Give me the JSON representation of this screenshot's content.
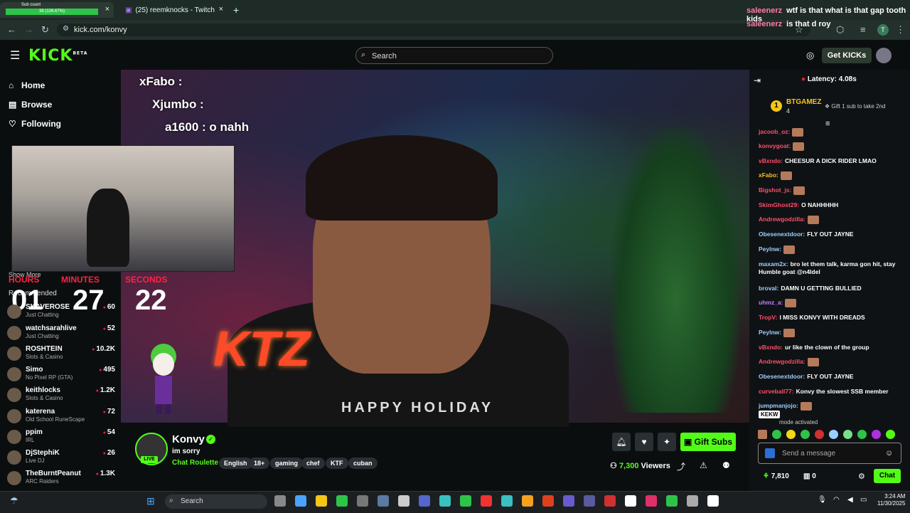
{
  "browser": {
    "tab1": {
      "title": "Sub count",
      "bar_text": "38 (126.67%)"
    },
    "tab2": {
      "title": "(25) reemknocks - Twitch"
    },
    "url": "kick.com/konvy",
    "close_glyph": "×",
    "new_tab_glyph": "+"
  },
  "overlay_chat": [
    {
      "user": "saleenerz",
      "text": "wtf is that what is that gap tooth kids"
    },
    {
      "user": "saleenerz",
      "text": "is that d roy"
    }
  ],
  "header": {
    "logo": "KICK",
    "logo_sup": "BETA",
    "search_placeholder": "Search",
    "get_kicks": "Get KICKs"
  },
  "sidebar": {
    "nav": [
      {
        "label": "Home",
        "icon": "home-icon"
      },
      {
        "label": "Browse",
        "icon": "browse-icon"
      },
      {
        "label": "Following",
        "icon": "heart-icon"
      }
    ],
    "show_more": "Show More",
    "recommended": "Recommended",
    "channels": [
      {
        "name": "SKAVEROSE",
        "category": "Just Chatting",
        "viewers": "60"
      },
      {
        "name": "watchsarahlive",
        "category": "Just Chatting",
        "viewers": "52"
      },
      {
        "name": "ROSHTEIN",
        "category": "Slots & Casino",
        "viewers": "10.2K"
      },
      {
        "name": "Simo",
        "category": "No Pixel RP (GTA)",
        "viewers": "495"
      },
      {
        "name": "keithlocks",
        "category": "Slots & Casino",
        "viewers": "1.2K"
      },
      {
        "name": "katerena",
        "category": "Old School RuneScape",
        "viewers": "72"
      },
      {
        "name": "ppim",
        "category": "IRL",
        "viewers": "54"
      },
      {
        "name": "DjStephiK",
        "category": "Live DJ",
        "viewers": "26"
      },
      {
        "name": "TheBurntPeanut",
        "category": "ARC Raiders",
        "viewers": "1.3K"
      }
    ]
  },
  "video": {
    "overlay_chat": [
      {
        "text": "xFabo :"
      },
      {
        "text": "Xjumbo :"
      },
      {
        "text": "a1600 : o nahh"
      }
    ],
    "timer": {
      "hours_label": "HOURS",
      "hours": "01",
      "minutes_label": "MINUTES",
      "minutes": "27",
      "seconds_label": "SECONDS",
      "seconds": "22"
    },
    "sign_text": "KTZ",
    "hoodie_text": "HAPPY HOLIDAY"
  },
  "channel": {
    "name": "Konvy",
    "live_badge": "LIVE",
    "stream_title": "im sorry",
    "category": "Chat Roulette",
    "tags": [
      "English",
      "18+",
      "gaming",
      "chef",
      "KTF",
      "cuban"
    ],
    "gift_subs": "Gift Subs",
    "viewers": "7,300",
    "viewers_label": "Viewers"
  },
  "chat": {
    "latency": "Latency: 4.08s",
    "top_gifter": {
      "name": "BTGAMEZ",
      "rank": "1",
      "count": "4"
    },
    "gift_prompt": "Gift 1 sub to take 2nd",
    "messages": [
      {
        "user": "jacoob_oz:",
        "text": "",
        "color": "#ff4d6d",
        "emote": true
      },
      {
        "user": "konvygoat:",
        "text": "",
        "color": "#ff4d6d",
        "emote": true
      },
      {
        "user": "vBxndo:",
        "text": "CHEESUR A DICK RIDER LMAO",
        "color": "#ff4d6d",
        "emote": false
      },
      {
        "user": "xFabo:",
        "text": "",
        "color": "#f5c518",
        "emote": true
      },
      {
        "user": "Bigshot_js:",
        "text": "",
        "color": "#ff4d6d",
        "emote": true
      },
      {
        "user": "SkimGhost29:",
        "text": "O NAHHHHH",
        "color": "#ff4d6d",
        "emote": false
      },
      {
        "user": "Andrewgodzilla:",
        "text": "",
        "color": "#ff4d6d",
        "emote": true
      },
      {
        "user": "Obesenextdoor:",
        "text": "FLY OUT JAYNE",
        "color": "#9ad0ff",
        "emote": false
      },
      {
        "user": "Peylnw:",
        "text": "",
        "color": "#9ad0ff",
        "emote": true
      },
      {
        "user": "maxam2x:",
        "text": "bro let them talk, karma gon hit, stay Humble goat @n4ldel",
        "color": "#9ad0ff",
        "emote": false
      },
      {
        "user": "broval:",
        "text": "DAMN U GETTING BULLIED",
        "color": "#9ad0ff",
        "emote": false
      },
      {
        "user": "uhmz_a:",
        "text": "",
        "color": "#c77dff",
        "emote": true
      },
      {
        "user": "TropV:",
        "text": "I MISS KONVY WITH DREADS",
        "color": "#ff4d6d",
        "emote": false
      },
      {
        "user": "Peylnw:",
        "text": "",
        "color": "#9ad0ff",
        "emote": true
      },
      {
        "user": "vBxndo:",
        "text": "ur like the clown of the group",
        "color": "#ff4d6d",
        "emote": false
      },
      {
        "user": "Andrewgodzilla:",
        "text": "",
        "color": "#ff4d6d",
        "emote": true
      },
      {
        "user": "Obesenextdoor:",
        "text": "FLY OUT JAYNE",
        "color": "#9ad0ff",
        "emote": false
      },
      {
        "user": "curveball77:",
        "text": "Konvy the slowest SSB member",
        "color": "#ff4d6d",
        "emote": false
      },
      {
        "user": "jumpmanjojo:",
        "text": "",
        "color": "#9ad0ff",
        "emote": true
      }
    ],
    "tooltip": "KEKW",
    "mode_text": "mode activated",
    "input_placeholder": "Send a message",
    "points": "7,810",
    "second_count": "0",
    "chat_button": "Chat"
  },
  "taskbar": {
    "search": "Search",
    "time": "3:24 AM",
    "date": "11/30/2025"
  }
}
